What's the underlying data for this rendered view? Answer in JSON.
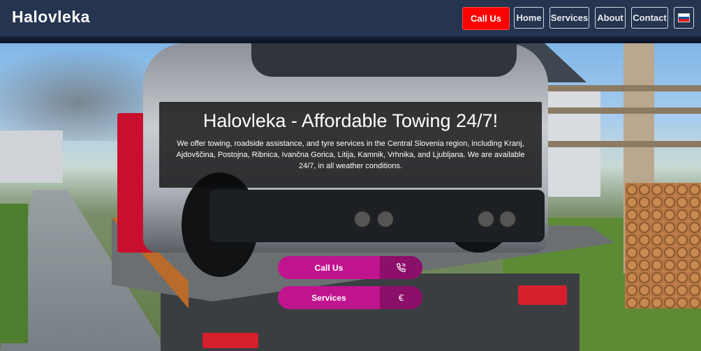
{
  "header": {
    "logo": "Halovleka",
    "call_label": "Call Us",
    "nav": [
      "Home",
      "Services",
      "About",
      "Contact"
    ],
    "language_flag": "slovenia-flag-icon"
  },
  "hero": {
    "title": "Halovleka - Affordable Towing 24/7!",
    "description": "We offer towing, roadside assistance, and tyre services in the Central Slovenia region, including Kranj, Ajdovščina, Postojna, Ribnica, Ivančna Gorica, Litija, Kamnik, Vrhnika, and Ljubljana. We are available 24/7, in all weather conditions.",
    "buttons": [
      {
        "label": "Call Us",
        "icon": "phone-icon"
      },
      {
        "label": "Services",
        "icon": "euro-icon"
      }
    ]
  },
  "colors": {
    "header_bg": "#25344f",
    "call_btn": "#ff0000",
    "cta": "#c0148f",
    "cta_icon": "#8c0f6a"
  }
}
